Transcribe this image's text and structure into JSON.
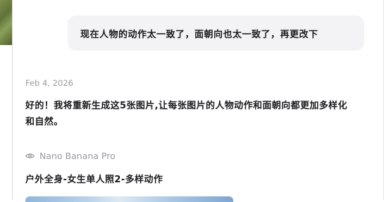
{
  "user_message": {
    "text": "现在人物的动作太一致了，面朝向也太一致了，再更改下"
  },
  "assistant": {
    "date": "Feb 4, 2026",
    "reply": "好的！我将重新生成这5张图片,让每张图片的人物动作和面朝向都更加多样化和自然。",
    "model_icon": "eye-icon",
    "model_name": "Nano Banana Pro",
    "image_title": "户外全身-女生单人照2-多样动作"
  },
  "colors": {
    "bubble_bg": "#f3f3f5",
    "text_primary": "#1c1c1f",
    "text_muted": "#9a9aa2"
  }
}
